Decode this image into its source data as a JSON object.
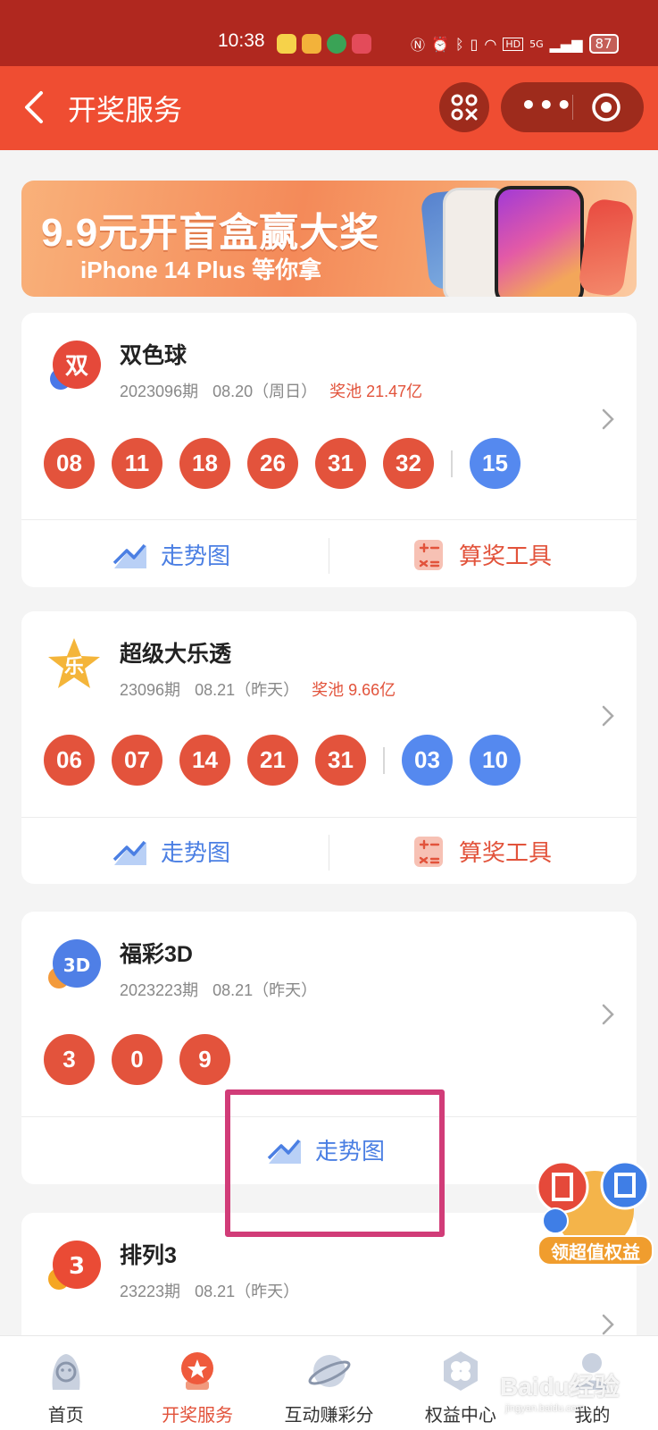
{
  "status_bar": {
    "time": "10:38",
    "battery": "87",
    "network": "5G"
  },
  "nav": {
    "title": "开奖服务",
    "more_label": "•••"
  },
  "banner": {
    "headline": "9.9元开盲盒赢大奖",
    "subline": "iPhone 14 Plus 等你拿"
  },
  "cards": [
    {
      "name": "双色球",
      "logo_char": "双",
      "issue": "2023096期",
      "date": "08.20（周日）",
      "pool": "奖池 21.47亿",
      "red_balls": [
        "08",
        "11",
        "18",
        "26",
        "31",
        "32"
      ],
      "blue_balls": [
        "15"
      ],
      "trend_label": "走势图",
      "tool_label": "算奖工具"
    },
    {
      "name": "超级大乐透",
      "logo_char": "乐",
      "issue": "23096期",
      "date": "08.21（昨天）",
      "pool": "奖池 9.66亿",
      "red_balls": [
        "06",
        "07",
        "14",
        "21",
        "31"
      ],
      "blue_balls": [
        "03",
        "10"
      ],
      "trend_label": "走势图",
      "tool_label": "算奖工具"
    },
    {
      "name": "福彩3D",
      "logo_char": "3D",
      "issue": "2023223期",
      "date": "08.21（昨天）",
      "red_balls": [
        "3",
        "0",
        "9"
      ],
      "trend_label": "走势图"
    },
    {
      "name": "排列3",
      "logo_char": "3",
      "issue": "23223期",
      "date": "08.21（昨天）"
    }
  ],
  "float_badge": {
    "label": "领超值权益"
  },
  "tabs": [
    {
      "label": "首页",
      "icon": "home-icon"
    },
    {
      "label": "开奖服务",
      "icon": "lottery-service-icon",
      "active": true
    },
    {
      "label": "互动赚彩分",
      "icon": "planet-icon"
    },
    {
      "label": "权益中心",
      "icon": "clover-hexagon-icon"
    },
    {
      "label": "我的",
      "icon": "profile-icon"
    }
  ],
  "watermark": {
    "text": "Baidu经验",
    "sub": "jingyan.baidu.com"
  },
  "colors": {
    "brand_red": "#ef4d32",
    "ball_red": "#e3533c",
    "ball_blue": "#5589ef",
    "link_blue": "#4b7fe3",
    "highlight": "#d13c78"
  }
}
